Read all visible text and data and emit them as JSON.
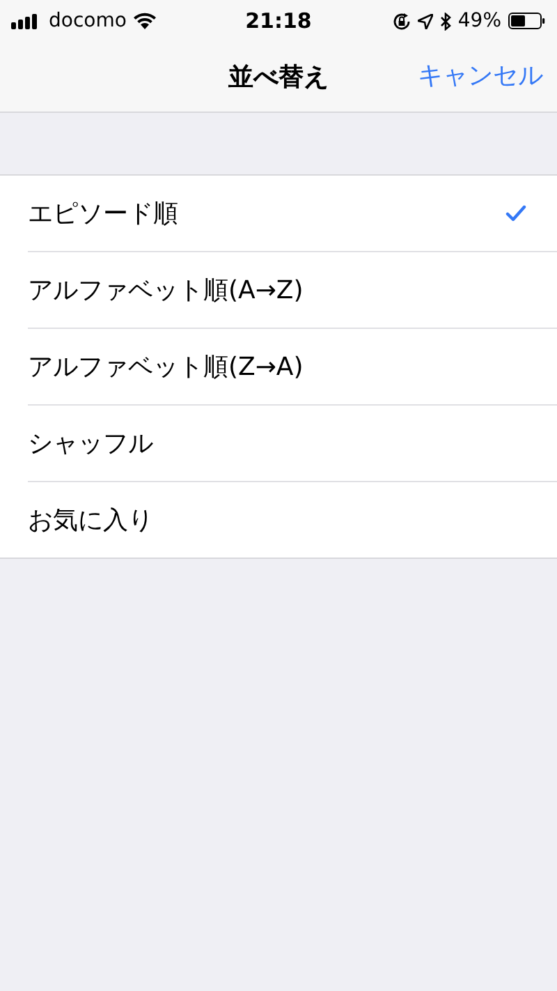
{
  "status_bar": {
    "carrier": "docomo",
    "time": "21:18",
    "battery": "49%"
  },
  "nav_bar": {
    "title": "並べ替え",
    "cancel": "キャンセル"
  },
  "options": [
    {
      "label": "エピソード順",
      "selected": true
    },
    {
      "label": "アルファベット順(A→Z)",
      "selected": false
    },
    {
      "label": "アルファベット順(Z→A)",
      "selected": false
    },
    {
      "label": "シャッフル",
      "selected": false
    },
    {
      "label": "お気に入り",
      "selected": false
    }
  ]
}
